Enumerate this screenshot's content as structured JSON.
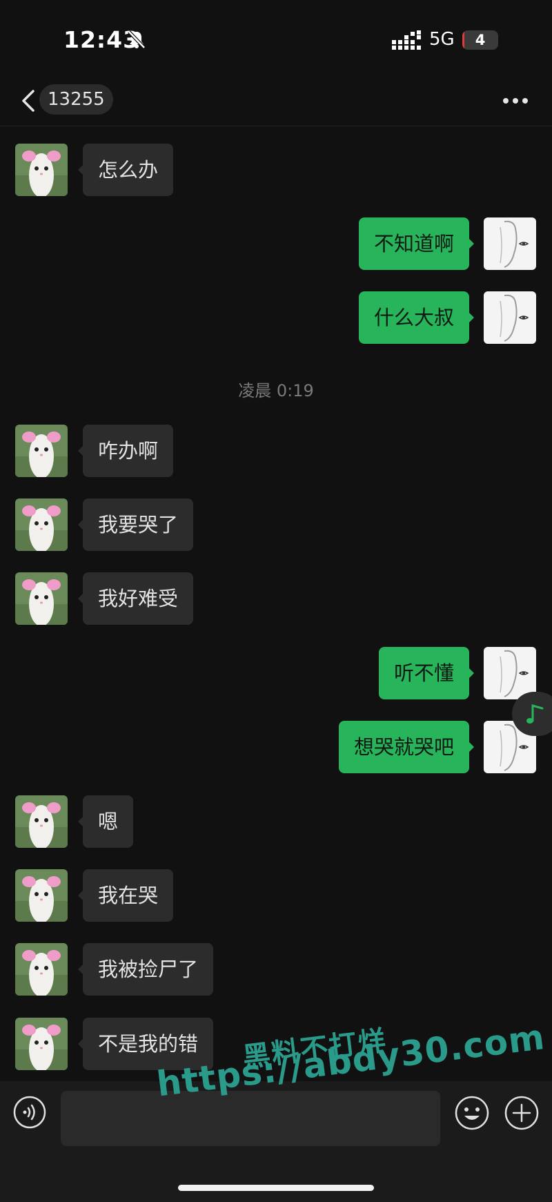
{
  "status_bar": {
    "time": "12:43",
    "network": "5G",
    "battery": "4",
    "battery_level": 0.04
  },
  "nav": {
    "contact": "13255",
    "ghost_text": "...,"
  },
  "colors": {
    "background": "#111111",
    "sent_bubble": "#27b45a",
    "received_bubble": "#2c2c2c",
    "watermark": "#2a9a8a"
  },
  "messages": [
    {
      "side": "left",
      "text": "怎么办"
    },
    {
      "side": "right",
      "text": "不知道啊"
    },
    {
      "side": "right",
      "text": "什么大叔"
    },
    {
      "side": "left",
      "text": "咋办啊"
    },
    {
      "side": "left",
      "text": "我要哭了"
    },
    {
      "side": "left",
      "text": "我好难受"
    },
    {
      "side": "right",
      "text": "听不懂"
    },
    {
      "side": "right",
      "text": "想哭就哭吧"
    },
    {
      "side": "left",
      "text": "嗯"
    },
    {
      "side": "left",
      "text": "我在哭"
    },
    {
      "side": "left",
      "text": "我被捡尸了"
    },
    {
      "side": "left",
      "text": "不是我的错"
    }
  ],
  "timestamp": "凌晨 0:19",
  "input": {
    "value": "",
    "placeholder": ""
  },
  "icons": {
    "back": "chevron-left-icon",
    "more": "more-horizontal-icon",
    "voice": "voice-icon",
    "emoji": "emoji-icon",
    "plus": "plus-icon",
    "music": "music-note-icon"
  },
  "watermark": {
    "line1": "黑料不打烊",
    "line2": "https://abdy30.com"
  }
}
